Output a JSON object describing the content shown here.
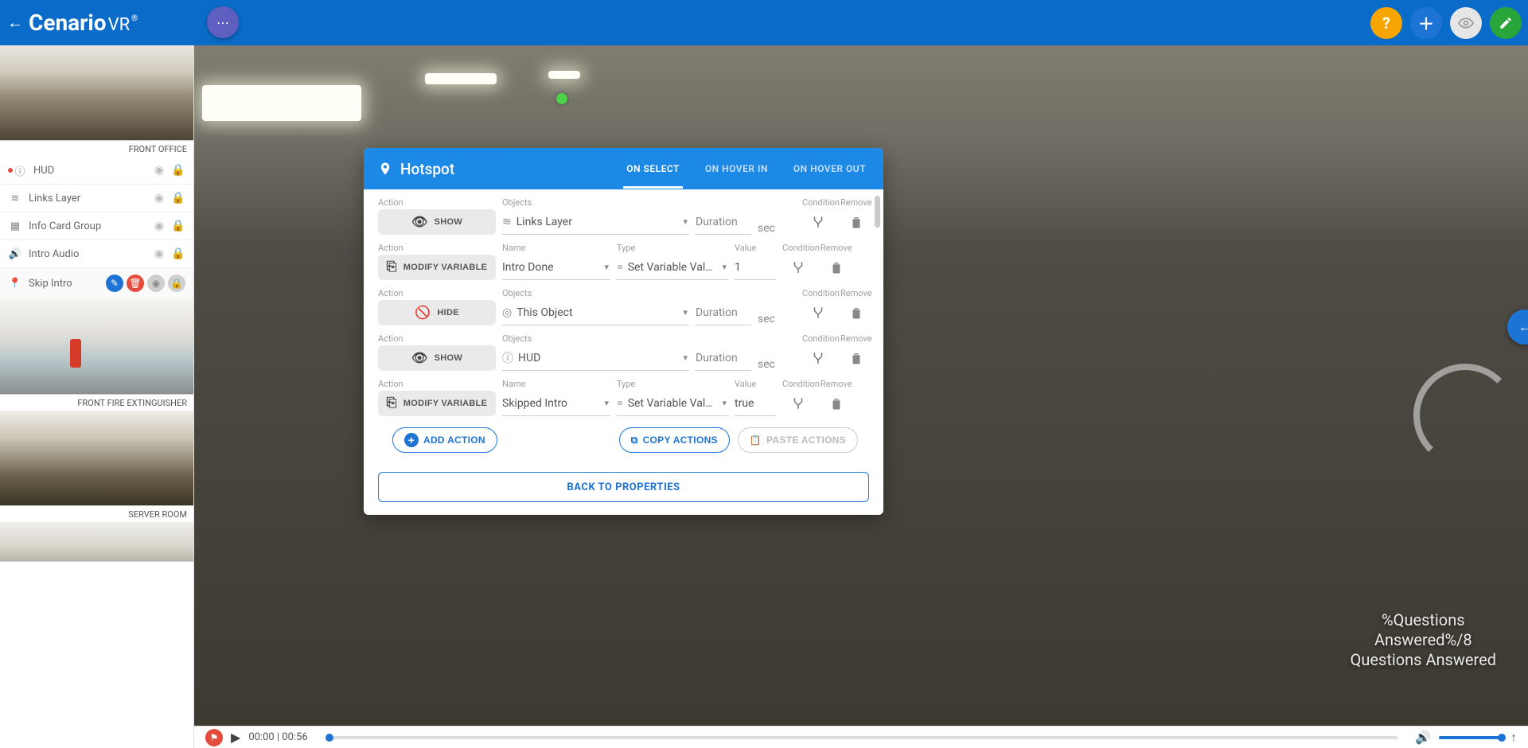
{
  "brand": {
    "name": "Cenario",
    "suffix": "VR"
  },
  "sidebar": {
    "scenes": [
      {
        "label": "FRONT OFFICE"
      },
      {
        "label": "FRONT FIRE EXTINGUISHER"
      },
      {
        "label": "SERVER ROOM"
      }
    ],
    "layers": [
      {
        "icon": "info",
        "label": "HUD"
      },
      {
        "icon": "layers",
        "label": "Links Layer"
      },
      {
        "icon": "grid",
        "label": "Info Card Group"
      },
      {
        "icon": "audio",
        "label": "Intro Audio"
      },
      {
        "icon": "pin",
        "label": "Skip Intro",
        "selected": true
      }
    ]
  },
  "dialog": {
    "title": "Hotspot",
    "tabs": [
      "ON SELECT",
      "ON HOVER IN",
      "ON HOVER OUT"
    ],
    "activeTab": 0,
    "columns": {
      "action": "Action",
      "objects": "Objects",
      "name": "Name",
      "type": "Type",
      "value": "Value",
      "condition": "Condition",
      "remove": "Remove",
      "duration": "Duration",
      "sec": "sec"
    },
    "actions": [
      {
        "kind": "show",
        "btn": "SHOW",
        "object": "Links Layer"
      },
      {
        "kind": "modify",
        "btn": "MODIFY VARIABLE",
        "name": "Intro Done",
        "type": "Set Variable Val…",
        "value": "1"
      },
      {
        "kind": "hide",
        "btn": "HIDE",
        "object": "This Object"
      },
      {
        "kind": "show",
        "btn": "SHOW",
        "object": "HUD"
      },
      {
        "kind": "modify",
        "btn": "MODIFY VARIABLE",
        "name": "Skipped Intro",
        "type": "Set Variable Val…",
        "value": "true"
      }
    ],
    "buttons": {
      "add": "ADD ACTION",
      "copy": "COPY ACTIONS",
      "paste": "PASTE ACTIONS",
      "back": "BACK TO PROPERTIES"
    }
  },
  "hud_text": {
    "line1": "%Questions",
    "line2": "Answered%/8",
    "line3": "Questions Answered"
  },
  "player": {
    "time": "00:00 | 00:56"
  }
}
